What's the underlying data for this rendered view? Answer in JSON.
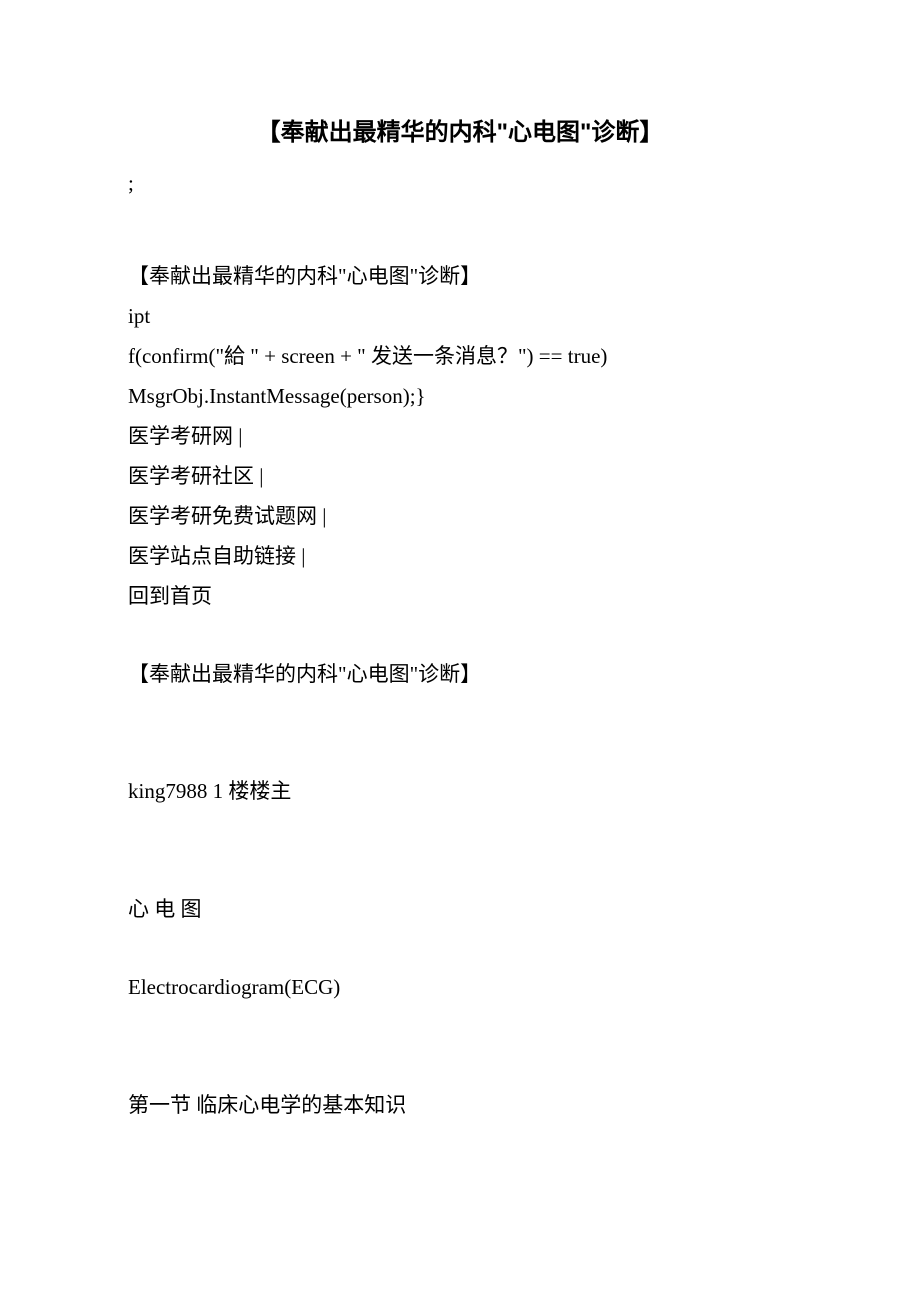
{
  "title": "【奉献出最精华的内科\"心电图\"诊断】",
  "semi": ";",
  "header_line": "【奉献出最精华的内科\"心电图\"诊断】",
  "code1": "ipt",
  "code2": "f(confirm(\"給 \" + screen + \" 发送一条消息？\") == true)",
  "code3": "MsgrObj.InstantMessage(person);}",
  "nav1": "医学考研网 |",
  "nav2": "医学考研社区 |",
  "nav3": "医学考研免费试题网 |",
  "nav4": "医学站点自助链接 |",
  "nav5": "回到首页",
  "repeat_header": "【奉献出最精华的内科\"心电图\"诊断】",
  "author": "king7988 1 楼楼主",
  "cn_title": "心 电 图",
  "en_title": "Electrocardiogram(ECG)",
  "section1": "第一节 临床心电学的基本知识"
}
